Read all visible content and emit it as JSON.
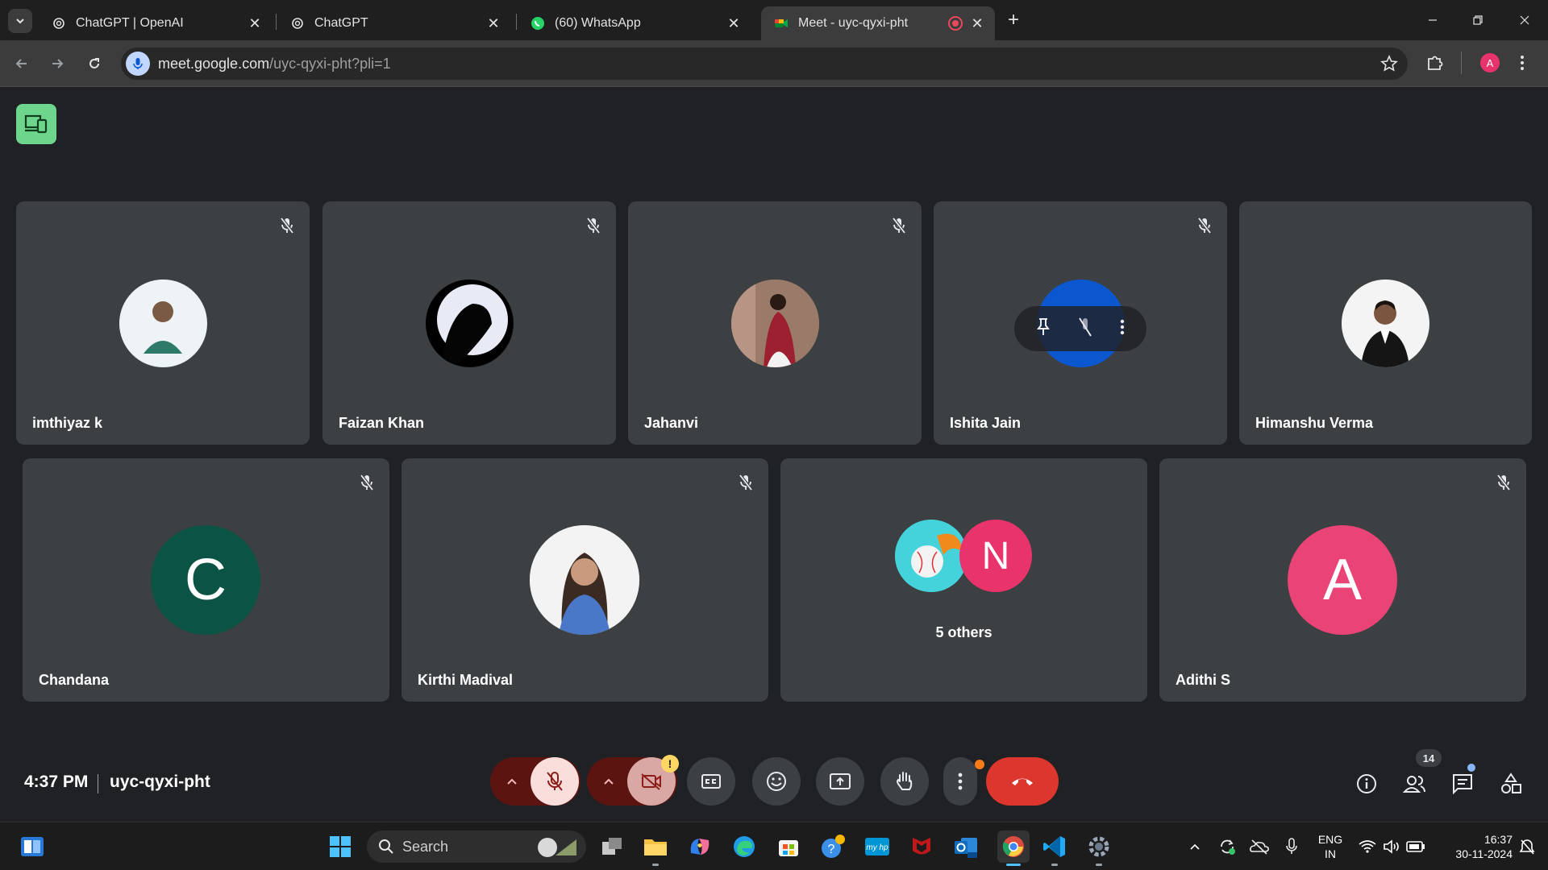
{
  "browser": {
    "tabs": [
      {
        "title": "ChatGPT | OpenAI",
        "active": false
      },
      {
        "title": "ChatGPT",
        "active": false
      },
      {
        "title": "(60) WhatsApp",
        "active": false
      },
      {
        "title": "Meet - uyc-qyxi-pht",
        "active": true
      }
    ],
    "url_host": "meet.google.com",
    "url_path": "/uyc-qyxi-pht?pli=1",
    "profile_initial": "A"
  },
  "meet": {
    "participants_row1": [
      {
        "name": "imthiyaz k",
        "muted": true
      },
      {
        "name": "Faizan Khan",
        "muted": true
      },
      {
        "name": "Jahanvi",
        "muted": true
      },
      {
        "name": "Ishita Jain",
        "muted": true
      },
      {
        "name": "Himanshu Verma",
        "muted": false
      }
    ],
    "participants_row2": [
      {
        "name": "Chandana",
        "initial": "C",
        "avatar_color": "#0b5345",
        "muted": true
      },
      {
        "name": "Kirthi Madival",
        "muted": true
      },
      {
        "name": "5 others",
        "initial": "N",
        "avatar_color": "#e8336b",
        "muted": false
      },
      {
        "name": "Adithi S",
        "initial": "A",
        "avatar_color": "#ea4477",
        "muted": true
      }
    ],
    "time": "4:37 PM",
    "meeting_code": "uyc-qyxi-pht",
    "people_count": "14",
    "camera_warning": "!"
  },
  "colors": {
    "accent_end_call": "#dc362e",
    "muted_red": "#8c1d18",
    "muted_pink": "#f9dedc",
    "companion_green": "#6dd58c"
  },
  "taskbar": {
    "search_label": "Search",
    "language_top": "ENG",
    "language_bottom": "IN",
    "clock_time": "16:37",
    "clock_date": "30-11-2024"
  }
}
